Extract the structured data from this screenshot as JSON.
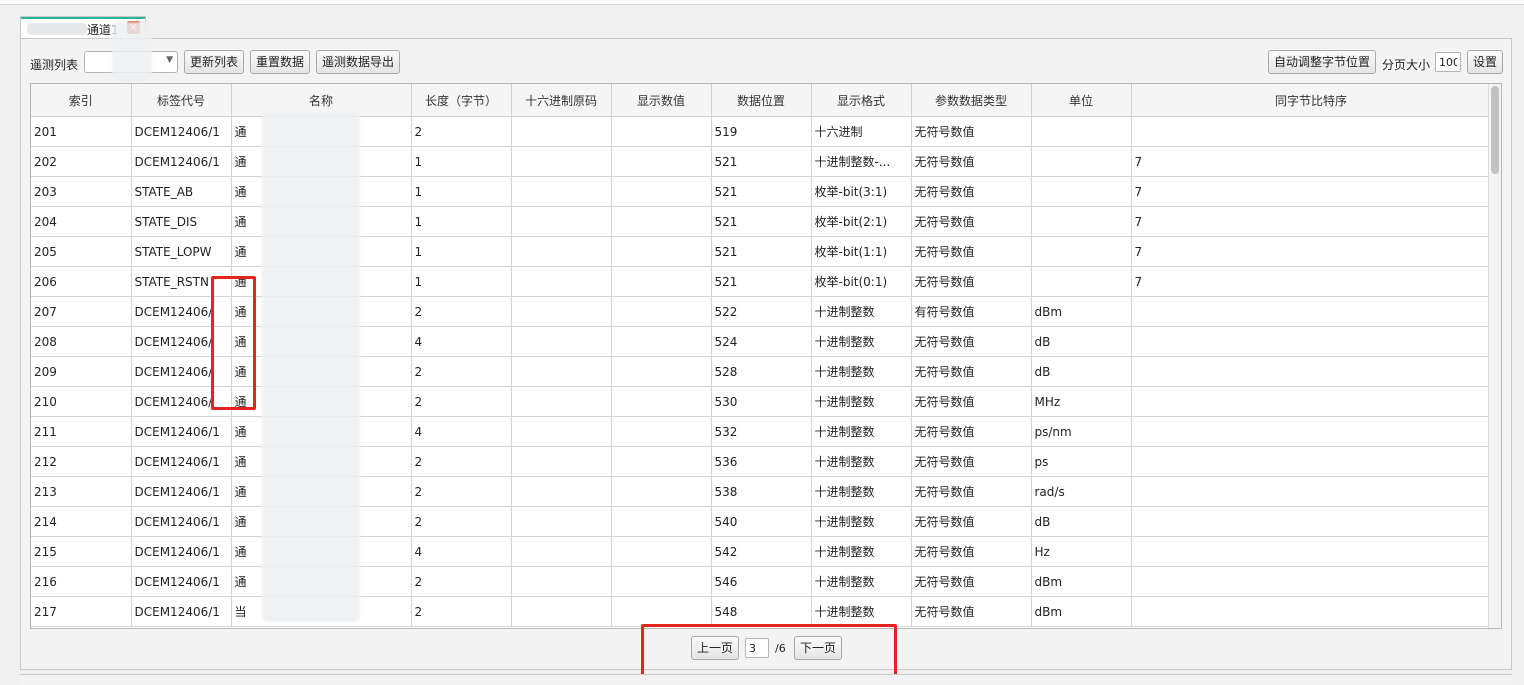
{
  "tab": {
    "label": "通道1",
    "close": "×"
  },
  "toolbar": {
    "list_label": "遥测列表",
    "list_value": "",
    "refresh_btn": "更新列表",
    "reload_btn": "重置数据",
    "export_btn": "遥测数据导出",
    "auto_btn": "自动调整字节位置",
    "page_size_label": "分页大小",
    "page_size_value": "100",
    "settings_btn": "设置"
  },
  "table": {
    "columns": [
      "索引",
      "标签代号",
      "名称",
      "长度（字节）",
      "十六进制原码",
      "显示数值",
      "数据位置",
      "显示格式",
      "参数数据类型",
      "单位",
      "同字节比特序"
    ],
    "rows": [
      [
        "201",
        "DCEM12406/1",
        "通",
        "2",
        "",
        "",
        "519",
        "十六进制",
        "无符号数值",
        "",
        ""
      ],
      [
        "202",
        "DCEM12406/1",
        "通",
        "1",
        "",
        "",
        "521",
        "十进制整数-...",
        "无符号数值",
        "",
        "7"
      ],
      [
        "203",
        "STATE_AB",
        "通",
        "1",
        "",
        "",
        "521",
        "枚举-bit(3:1)",
        "无符号数值",
        "",
        "7"
      ],
      [
        "204",
        "STATE_DIS",
        "通",
        "1",
        "",
        "",
        "521",
        "枚举-bit(2:1)",
        "无符号数值",
        "",
        "7"
      ],
      [
        "205",
        "STATE_LOPW",
        "通",
        "1",
        "",
        "",
        "521",
        "枚举-bit(1:1)",
        "无符号数值",
        "",
        "7"
      ],
      [
        "206",
        "STATE_RSTN",
        "通",
        "1",
        "",
        "",
        "521",
        "枚举-bit(0:1)",
        "无符号数值",
        "",
        "7"
      ],
      [
        "207",
        "DCEM12406/",
        "通",
        "2",
        "",
        "",
        "522",
        "十进制整数",
        "有符号数值",
        "dBm",
        ""
      ],
      [
        "208",
        "DCEM12406/",
        "通",
        "4",
        "",
        "",
        "524",
        "十进制整数",
        "无符号数值",
        "dB",
        ""
      ],
      [
        "209",
        "DCEM12406/",
        "通",
        "2",
        "",
        "",
        "528",
        "十进制整数",
        "无符号数值",
        "dB",
        ""
      ],
      [
        "210",
        "DCEM12406/",
        "通",
        "2",
        "",
        "",
        "530",
        "十进制整数",
        "无符号数值",
        "MHz",
        ""
      ],
      [
        "211",
        "DCEM12406/1",
        "通",
        "4",
        "",
        "",
        "532",
        "十进制整数",
        "无符号数值",
        "ps/nm",
        ""
      ],
      [
        "212",
        "DCEM12406/1",
        "通",
        "2",
        "",
        "",
        "536",
        "十进制整数",
        "无符号数值",
        "ps",
        ""
      ],
      [
        "213",
        "DCEM12406/1",
        "通",
        "2",
        "",
        "",
        "538",
        "十进制整数",
        "无符号数值",
        "rad/s",
        ""
      ],
      [
        "214",
        "DCEM12406/1",
        "通",
        "2",
        "",
        "",
        "540",
        "十进制整数",
        "无符号数值",
        "dB",
        ""
      ],
      [
        "215",
        "DCEM12406/1",
        "通",
        "4",
        "",
        "",
        "542",
        "十进制整数",
        "无符号数值",
        "Hz",
        ""
      ],
      [
        "216",
        "DCEM12406/1",
        "通",
        "2",
        "",
        "",
        "546",
        "十进制整数",
        "无符号数值",
        "dBm",
        ""
      ],
      [
        "217",
        "DCEM12406/1",
        "当",
        "2",
        "",
        "",
        "548",
        "十进制整数",
        "无符号数值",
        "dBm",
        ""
      ]
    ]
  },
  "pager": {
    "prev_btn": "上一页",
    "current_page": "3",
    "total_label": "/6",
    "next_btn": "下一页"
  },
  "colors": {
    "highlight_red": "#e8231c",
    "tab_accent": "#2bb3a1",
    "close_icon": "#e2522d"
  }
}
